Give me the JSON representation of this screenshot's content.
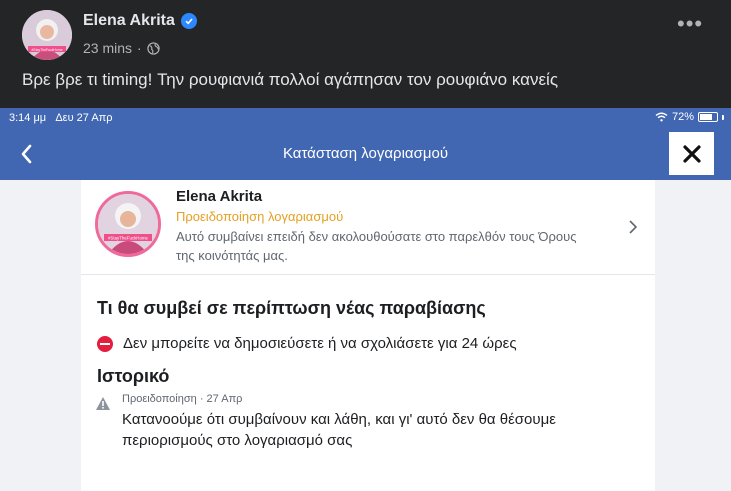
{
  "post": {
    "author": "Elena Akrita",
    "time": "23 mins",
    "separator": "·",
    "text": "Βρε βρε τι timing! Την ρουφιανιά πολλοί αγάπησαν τον ρουφιάνο κανείς",
    "avatar_caption": "#StayTheFuckHome"
  },
  "statusbar": {
    "time": "3:14 μμ",
    "date": "Δευ 27 Απρ",
    "battery": "72%",
    "battery_level": 0.72
  },
  "navbar": {
    "title": "Κατάσταση λογαριασμού"
  },
  "account": {
    "name": "Elena Akrita",
    "status": "Προειδοποίηση λογαριασμού",
    "description": "Αυτό συμβαίνει επειδή δεν ακολουθούσατε στο παρελθόν τους Όρους της κοινότητάς μας.",
    "avatar_caption": "#StayTheFuckHome"
  },
  "violation": {
    "title": "Τι θα συμβεί σε περίπτωση νέας παραβίασης",
    "restriction": "Δεν μπορείτε να δημοσιεύσετε ή να σχολιάσετε για 24 ώρες"
  },
  "history": {
    "title": "Ιστορικό",
    "meta": "Προειδοποίηση · 27 Απρ",
    "text": "Κατανοούμε ότι συμβαίνουν και λάθη, και γι' αυτό δεν θα θέσουμε περιορισμούς στο λογαριασμό σας"
  },
  "colors": {
    "facebook_blue": "#4267b2",
    "dark_bg": "#242526",
    "warning_orange": "#e4a123",
    "stop_red": "#e41e3f",
    "verified_blue": "#2d88ff"
  }
}
